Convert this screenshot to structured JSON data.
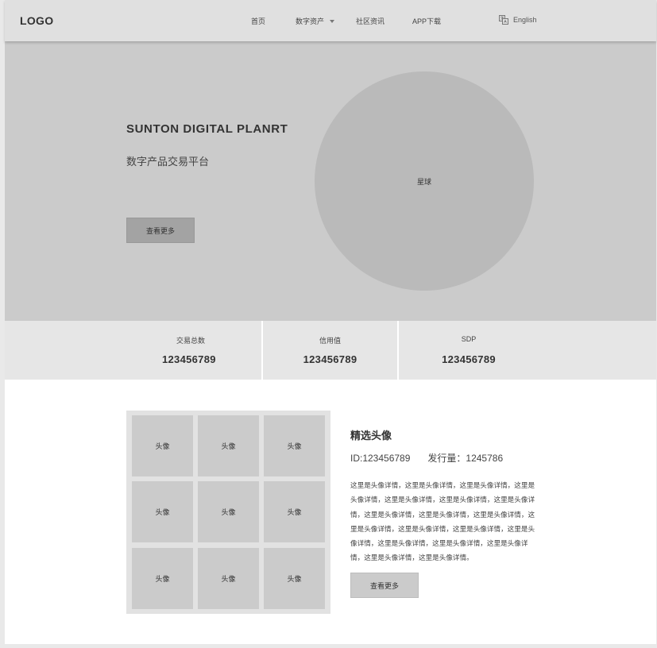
{
  "header": {
    "logo": "LOGO",
    "nav": [
      "首页",
      "数字资产",
      "社区资讯",
      "APP下载"
    ],
    "lang_icon": "translate-icon",
    "lang_label": "English"
  },
  "hero": {
    "title": "SUNTON DIGITAL PLANRT",
    "subtitle": "数字产品交易平台",
    "button": "查看更多",
    "planet_label": "星球"
  },
  "stats": [
    {
      "label": "交易总数",
      "value": "123456789"
    },
    {
      "label": "信用值",
      "value": "123456789"
    },
    {
      "label": "SDP",
      "value": "123456789"
    }
  ],
  "featured": {
    "avatars": [
      "头像",
      "头像",
      "头像",
      "头像",
      "头像",
      "头像",
      "头像",
      "头像",
      "头像"
    ],
    "title": "精选头像",
    "id": "ID:123456789",
    "issue": "发行量：1245786",
    "desc": "这里是头像详情，这里是头像详情，这里是头像详情，这里是头像详情，这里是头像详情，这里是头像详情，这里是头像详情，这里是头像详情，这里是头像详情，这里是头像详情，这里是头像详情，这里是头像详情，这里是头像详情，这里是头像详情，这里是头像详情，这里是头像详情，这里是头像详情，这里是头像详情，这里是头像详情。",
    "button": "查看更多"
  },
  "colors": {
    "header_bg": "#e0e0e0",
    "hero_bg": "#cbcbcb",
    "planet": "#bababa",
    "stats_bg": "#e6e6e6"
  }
}
